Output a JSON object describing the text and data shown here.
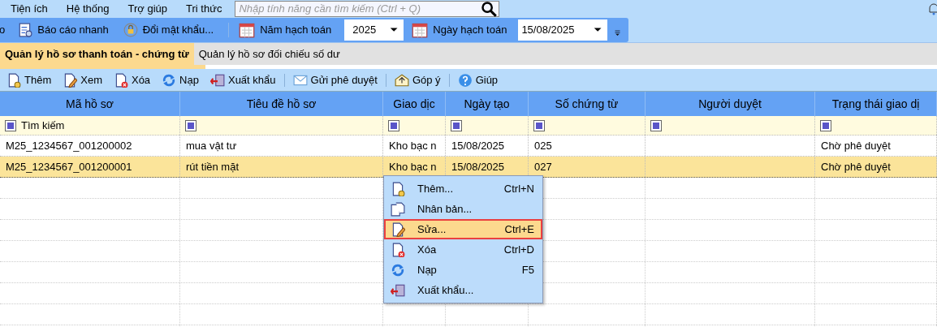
{
  "menu_bar": {
    "items": [
      "Tiện ích",
      "Hệ thống",
      "Trợ giúp",
      "Tri thức"
    ],
    "search": {
      "placeholder": "Nhập tính năng cần tìm kiếm (Ctrl + Q)"
    }
  },
  "toolbar": {
    "cut_text": "o",
    "buttons": [
      "Báo cáo nhanh",
      "Đổi mật khẩu..."
    ],
    "year_label": "Năm hạch toán",
    "year_value": "2025",
    "date_label": "Ngày hạch toán",
    "date_value": "15/08/2025"
  },
  "tabs": [
    {
      "label": "Quản lý hồ sơ thanh toán - chứng từ",
      "selected": true
    },
    {
      "label": "Quản lý hồ sơ đối chiếu số dư",
      "selected": false
    }
  ],
  "actions": [
    "Thêm",
    "Xem",
    "Xóa",
    "Nạp",
    "Xuất khẩu",
    "Gửi phê duyệt",
    "Góp ý",
    "Giúp"
  ],
  "table": {
    "columns": [
      "Mã hồ sơ",
      "Tiêu đề hồ sơ",
      "Giao dịc",
      "Ngày tạo",
      "Số chứng từ",
      "Người duyệt",
      "Trạng thái giao dị"
    ],
    "filter_placeholder": "Tìm kiếm",
    "rows": [
      {
        "cells": [
          "M25_1234567_001200002",
          "mua vật tư",
          "Kho bạc n",
          "15/08/2025",
          "025",
          "",
          "Chờ phê duyệt"
        ],
        "selected": false
      },
      {
        "cells": [
          "M25_1234567_001200001",
          "rút tiền mặt",
          "Kho bạc n",
          "15/08/2025",
          "027",
          "",
          "Chờ phê duyệt"
        ],
        "selected": true
      }
    ]
  },
  "context_menu": {
    "items": [
      {
        "label": "Thêm...",
        "shortcut": "Ctrl+N",
        "selected": false
      },
      {
        "label": "Nhân bản...",
        "selected": false
      },
      {
        "label": "Sửa...",
        "shortcut": "Ctrl+E",
        "selected": true
      },
      {
        "label": "Xóa",
        "shortcut": "Ctrl+D",
        "selected": false
      },
      {
        "label": "Nạp",
        "shortcut": "F5",
        "selected": false
      },
      {
        "label": "Xuất khẩu...",
        "selected": false
      }
    ]
  }
}
